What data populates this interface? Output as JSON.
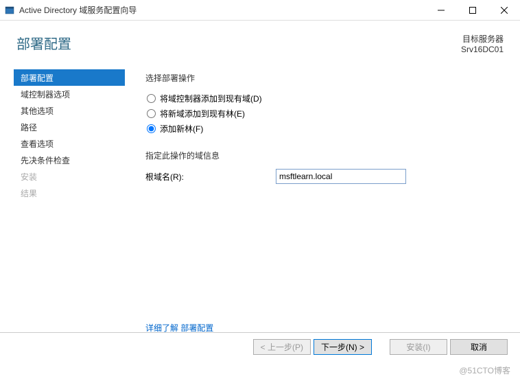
{
  "window": {
    "title": "Active Directory 域服务配置向导"
  },
  "header": {
    "page_title": "部署配置",
    "target_label": "目标服务器",
    "target_server": "Srv16DC01"
  },
  "sidebar": {
    "items": [
      {
        "label": "部署配置",
        "active": true
      },
      {
        "label": "域控制器选项"
      },
      {
        "label": "其他选项"
      },
      {
        "label": "路径"
      },
      {
        "label": "查看选项"
      },
      {
        "label": "先决条件检查"
      },
      {
        "label": "安装",
        "disabled": true
      },
      {
        "label": "结果",
        "disabled": true
      }
    ]
  },
  "main": {
    "select_op_label": "选择部署操作",
    "radios": [
      {
        "label": "将域控制器添加到现有域(D)"
      },
      {
        "label": "将新域添加到现有林(E)"
      },
      {
        "label": "添加新林(F)",
        "checked": true
      }
    ],
    "domain_info_label": "指定此操作的域信息",
    "root_domain_label": "根域名(R):",
    "root_domain_value": "msftlearn.local"
  },
  "more": {
    "text": "详细了解 ",
    "link": "部署配置"
  },
  "footer": {
    "prev": "< 上一步(P)",
    "next": "下一步(N) >",
    "install": "安装(I)",
    "cancel": "取消"
  },
  "watermark": "@51CTO博客"
}
